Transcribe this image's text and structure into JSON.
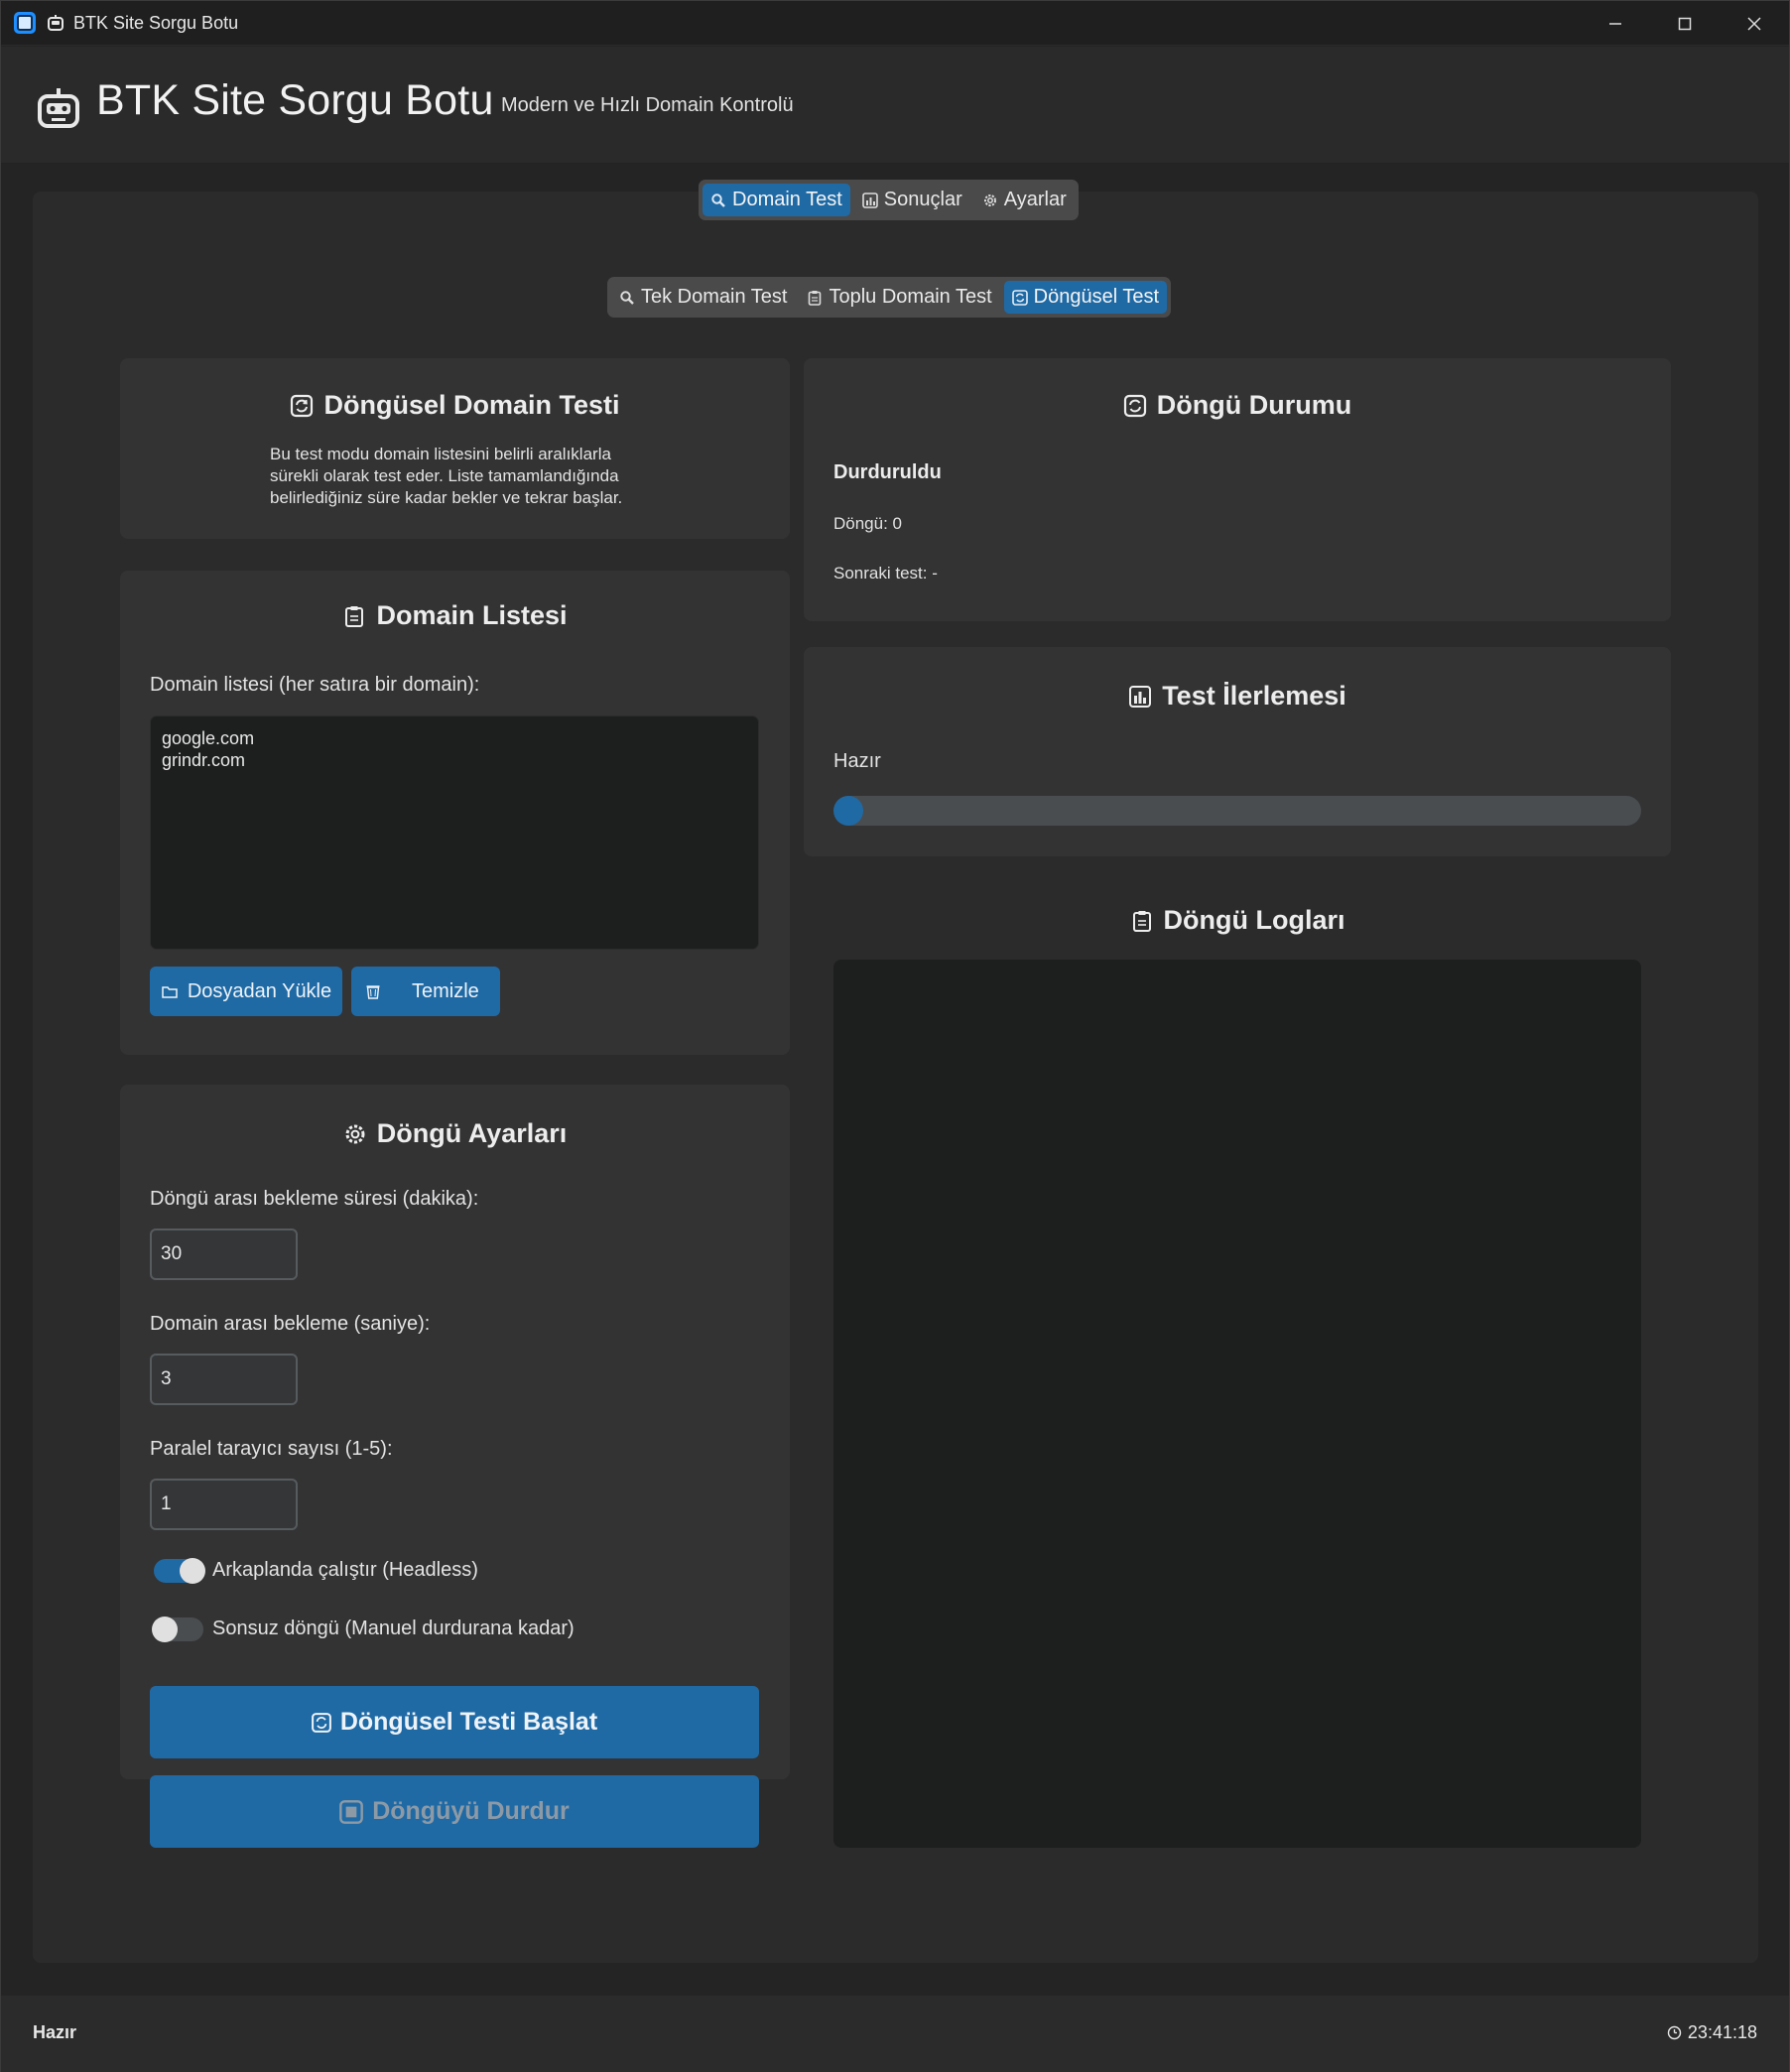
{
  "window": {
    "title": "BTK Site Sorgu Botu",
    "controls": [
      "minimize",
      "maximize",
      "close"
    ]
  },
  "header": {
    "title": "BTK Site Sorgu Botu",
    "subtitle": "Modern ve Hızlı Domain Kontrolü",
    "icon": "robot-icon"
  },
  "main_tabs": [
    {
      "label": "Domain Test",
      "icon": "magnifier-icon",
      "active": true
    },
    {
      "label": "Sonuçlar",
      "icon": "bar-chart-icon",
      "active": false
    },
    {
      "label": "Ayarlar",
      "icon": "gear-icon",
      "active": false
    }
  ],
  "sub_tabs": [
    {
      "label": "Tek Domain Test",
      "icon": "magnifier-icon",
      "active": false
    },
    {
      "label": "Toplu Domain Test",
      "icon": "clipboard-icon",
      "active": false
    },
    {
      "label": "Döngüsel Test",
      "icon": "cycle-icon",
      "active": true
    }
  ],
  "intro": {
    "title": "Döngüsel Domain Testi",
    "description_lines": [
      "Bu test modu domain listesini belirli aralıklarla",
      "sürekli olarak test eder. Liste tamamlandığında",
      "belirlediğiniz süre kadar bekler ve tekrar başlar."
    ]
  },
  "domain_list": {
    "title": "Domain Listesi",
    "label": "Domain listesi (her satıra bir domain):",
    "content": "google.com\ngrindr.com",
    "load_button": "Dosyadan Yükle",
    "clear_button": "Temizle"
  },
  "settings": {
    "title": "Döngü Ayarları",
    "cycle_wait_label": "Döngü arası bekleme süresi (dakika):",
    "cycle_wait_value": "30",
    "domain_wait_label": "Domain arası bekleme (saniye):",
    "domain_wait_value": "3",
    "parallel_label": "Paralel tarayıcı sayısı (1-5):",
    "parallel_value": "1",
    "headless_label": "Arkaplanda çalıştır (Headless)",
    "headless_on": true,
    "infinite_label": "Sonsuz döngü (Manuel durdurana kadar)",
    "infinite_on": false,
    "start_button": "Döngüsel Testi Başlat",
    "stop_button": "Döngüyü Durdur"
  },
  "status": {
    "title": "Döngü Durumu",
    "state": "Durduruldu",
    "cycle_text": "Döngü: 0",
    "next_text": "Sonraki test: -"
  },
  "progress": {
    "title": "Test İlerlemesi",
    "label": "Hazır",
    "value": 0.0
  },
  "logs": {
    "title": "Döngü Logları",
    "content": ""
  },
  "statusbar": {
    "left": "Hazır",
    "time": "23:41:18"
  },
  "colors": {
    "accent": "#1f6aa5",
    "window_bg": "#242424",
    "card_bg": "#333334",
    "input_bg": "#1d1e1e"
  }
}
